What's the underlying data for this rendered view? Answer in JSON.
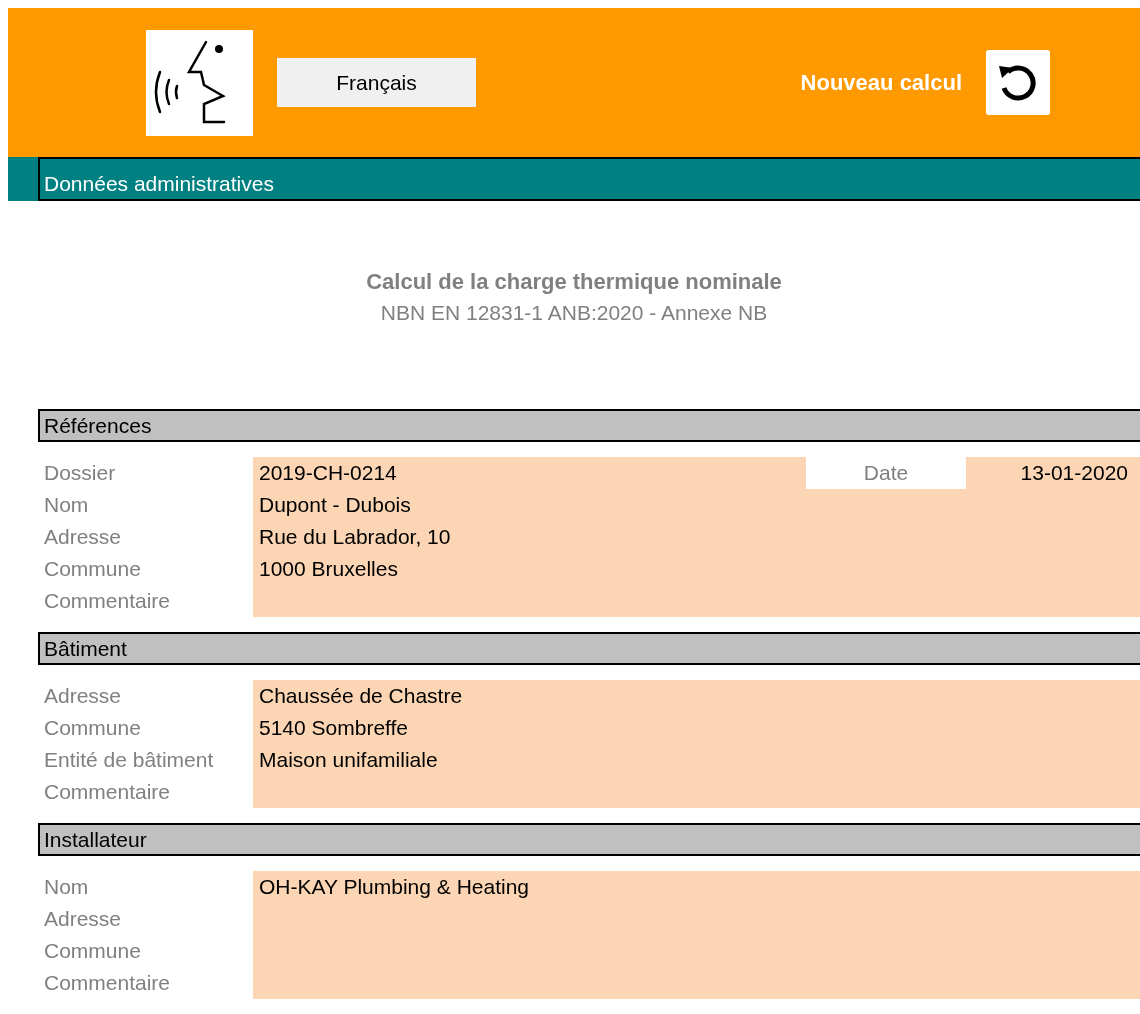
{
  "header": {
    "language_button": "Français",
    "new_calc_label": "Nouveau calcul"
  },
  "section_bar": {
    "title": "Données administratives"
  },
  "title": {
    "main": "Calcul de la charge thermique nominale",
    "subtitle": "NBN EN 12831-1 ANB:2020 - Annexe NB"
  },
  "sections": [
    {
      "title": "Références",
      "date": {
        "label": "Date",
        "value": "13-01-2020"
      },
      "fields": [
        {
          "label": "Dossier",
          "value": "2019-CH-0214"
        },
        {
          "label": "Nom",
          "value": "Dupont - Dubois"
        },
        {
          "label": "Adresse",
          "value": "Rue du Labrador, 10"
        },
        {
          "label": "Commune",
          "value": "1000 Bruxelles"
        },
        {
          "label": "Commentaire"
        }
      ]
    },
    {
      "title": "Bâtiment",
      "fields": [
        {
          "label": "Adresse",
          "value": "Chaussée de Chastre"
        },
        {
          "label": "Commune",
          "value": "5140 Sombreffe"
        },
        {
          "label": "Entité de bâtiment",
          "value": "Maison unifamiliale"
        },
        {
          "label": "Commentaire"
        }
      ]
    },
    {
      "title": "Installateur",
      "fields": [
        {
          "label": "Nom",
          "value": "OH-KAY Plumbing & Heating"
        },
        {
          "label": "Adresse"
        },
        {
          "label": "Commune"
        },
        {
          "label": "Commentaire"
        }
      ]
    }
  ]
}
